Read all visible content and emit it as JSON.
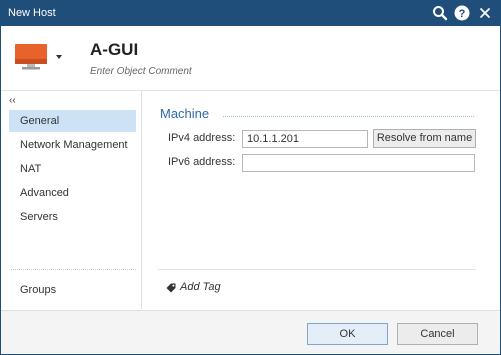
{
  "window": {
    "title": "New Host"
  },
  "header": {
    "object_name": "A-GUI",
    "comment_placeholder": "Enter Object Comment"
  },
  "sidebar": {
    "collapse_label": "‹‹",
    "items": [
      {
        "label": "General",
        "selected": true
      },
      {
        "label": "Network Management"
      },
      {
        "label": "NAT"
      },
      {
        "label": "Advanced"
      },
      {
        "label": "Servers"
      }
    ],
    "bottom_item": {
      "label": "Groups"
    }
  },
  "machine": {
    "section_title": "Machine",
    "ipv4_label": "IPv4 address:",
    "ipv4_value": "10.1.1.201",
    "ipv6_label": "IPv6 address:",
    "ipv6_value": "",
    "resolve_label": "Resolve from name"
  },
  "tags": {
    "add_label": "Add Tag"
  },
  "footer": {
    "ok_label": "OK",
    "cancel_label": "Cancel"
  },
  "colors": {
    "titlebar": "#1e4e79",
    "selected_nav": "#cde3f5",
    "section_title": "#2f6aa8",
    "host_icon": "#e8632c"
  }
}
